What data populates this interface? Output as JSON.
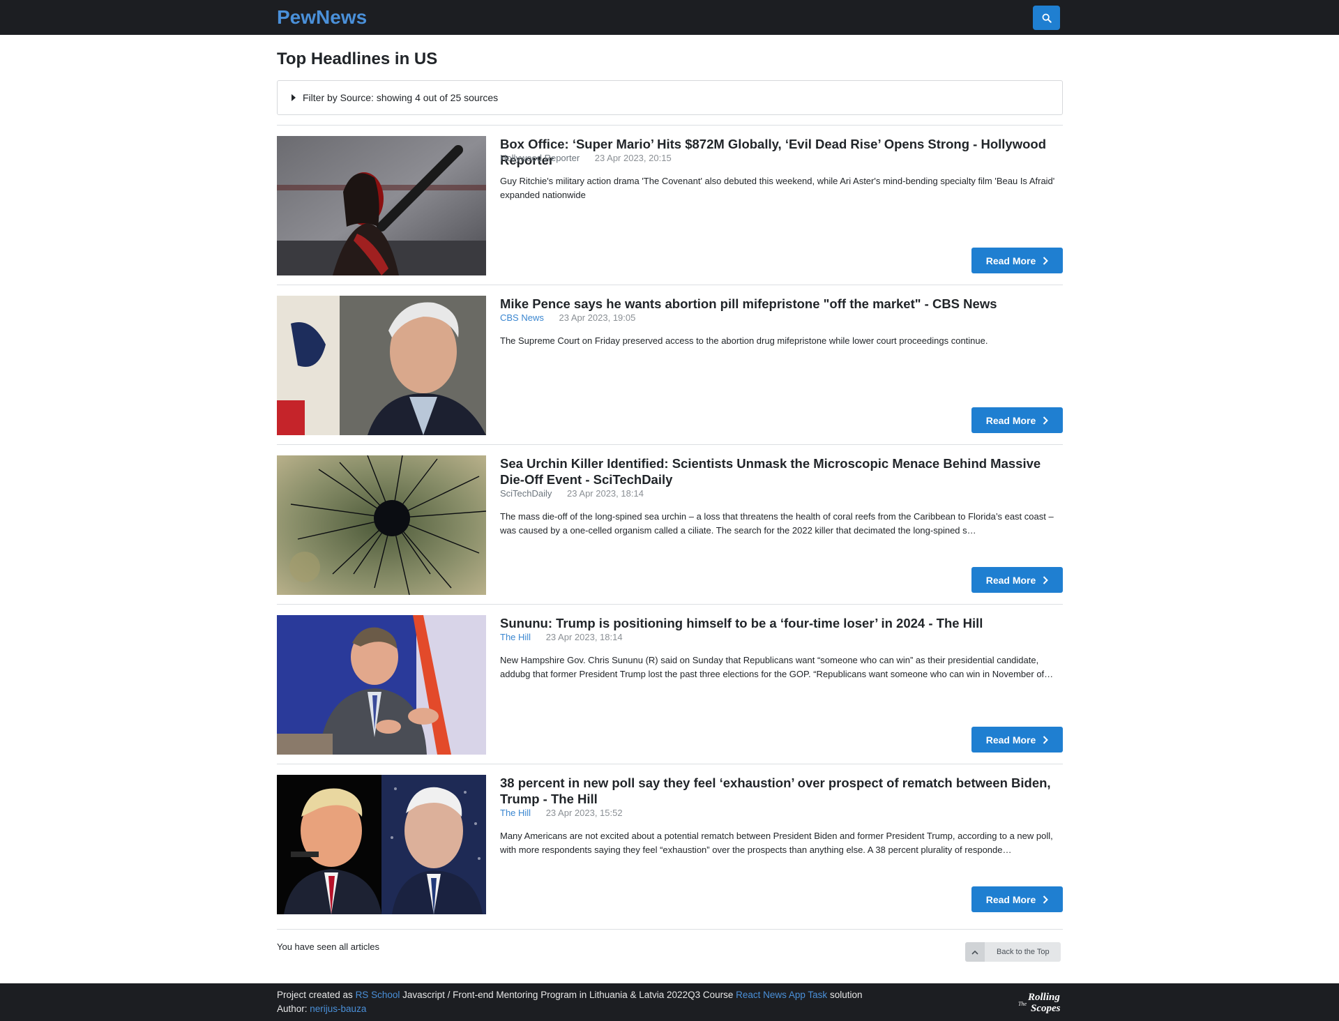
{
  "header": {
    "brand": "PewNews"
  },
  "page": {
    "title": "Top Headlines in US",
    "filter_label": "Filter by Source: showing 4 out of 25 sources"
  },
  "articles": [
    {
      "title": "Box Office: ‘Super Mario’ Hits $872M Globally, ‘Evil Dead Rise’ Opens Strong - Hollywood Reporter",
      "source": "Hollywood Reporter",
      "date": "23 Apr 2023, 20:15",
      "description": "Guy Ritchie's military action drama 'The Covenant' also debuted this weekend, while Ari Aster's mind-bending specialty film 'Beau Is Afraid' expanded nationwide",
      "button": "Read More"
    },
    {
      "title": "Mike Pence says he wants abortion pill mifepristone \"off the market\" - CBS News",
      "source": "CBS News",
      "date": "23 Apr 2023, 19:05",
      "description": "The Supreme Court on Friday preserved access to the abortion drug mifepristone while lower court proceedings continue.",
      "button": "Read More"
    },
    {
      "title": "Sea Urchin Killer Identified: Scientists Unmask the Microscopic Menace Behind Massive Die-Off Event - SciTechDaily",
      "source": "SciTechDaily",
      "date": "23 Apr 2023, 18:14",
      "description": "The mass die-off of the long-spined sea urchin – a loss that threatens the health of coral reefs from the Caribbean to Florida’s east coast – was caused by a one-celled organism called a ciliate. The search for the 2022 killer that decimated the long-spined s…",
      "button": "Read More"
    },
    {
      "title": "Sununu: Trump is positioning himself to be a ‘four-time loser’ in 2024 - The Hill",
      "source": "The Hill",
      "date": "23 Apr 2023, 18:14",
      "description": "New Hampshire Gov. Chris Sununu (R) said on Sunday that Republicans want “someone who can win” as their presidential candidate, addubg that former President Trump lost the past three elections for the GOP.  “Republicans want someone who can win in November of…",
      "button": "Read More"
    },
    {
      "title": "38 percent in new poll say they feel ‘exhaustion’ over prospect of rematch between Biden, Trump - The Hill",
      "source": "The Hill",
      "date": "23 Apr 2023, 15:52",
      "description": "Many Americans are not excited about a potential rematch between President Biden and former President Trump, according to a new poll, with more respondents saying they feel “exhaustion” over the prospects than anything else. A 38 percent plurality of responde…",
      "button": "Read More"
    }
  ],
  "end": {
    "seen_all": "You have seen all articles",
    "back_to_top": "Back to the Top"
  },
  "footer": {
    "prefix": "Project created as ",
    "rs_school": "RS School",
    "middle": " Javascript / Front-end Mentoring Program in Lithuania & Latvia 2022Q3 Course ",
    "task_link": "React News App Task",
    "suffix": " solution",
    "author_label": "Author: ",
    "author": "nerijus-bauza",
    "logo_text_1": "The",
    "logo_text_2": "Rolling",
    "logo_text_3": "Scopes"
  },
  "colors": {
    "accent": "#1f7fd1",
    "brand": "#4a90d9",
    "navbar": "#1c1e22"
  }
}
